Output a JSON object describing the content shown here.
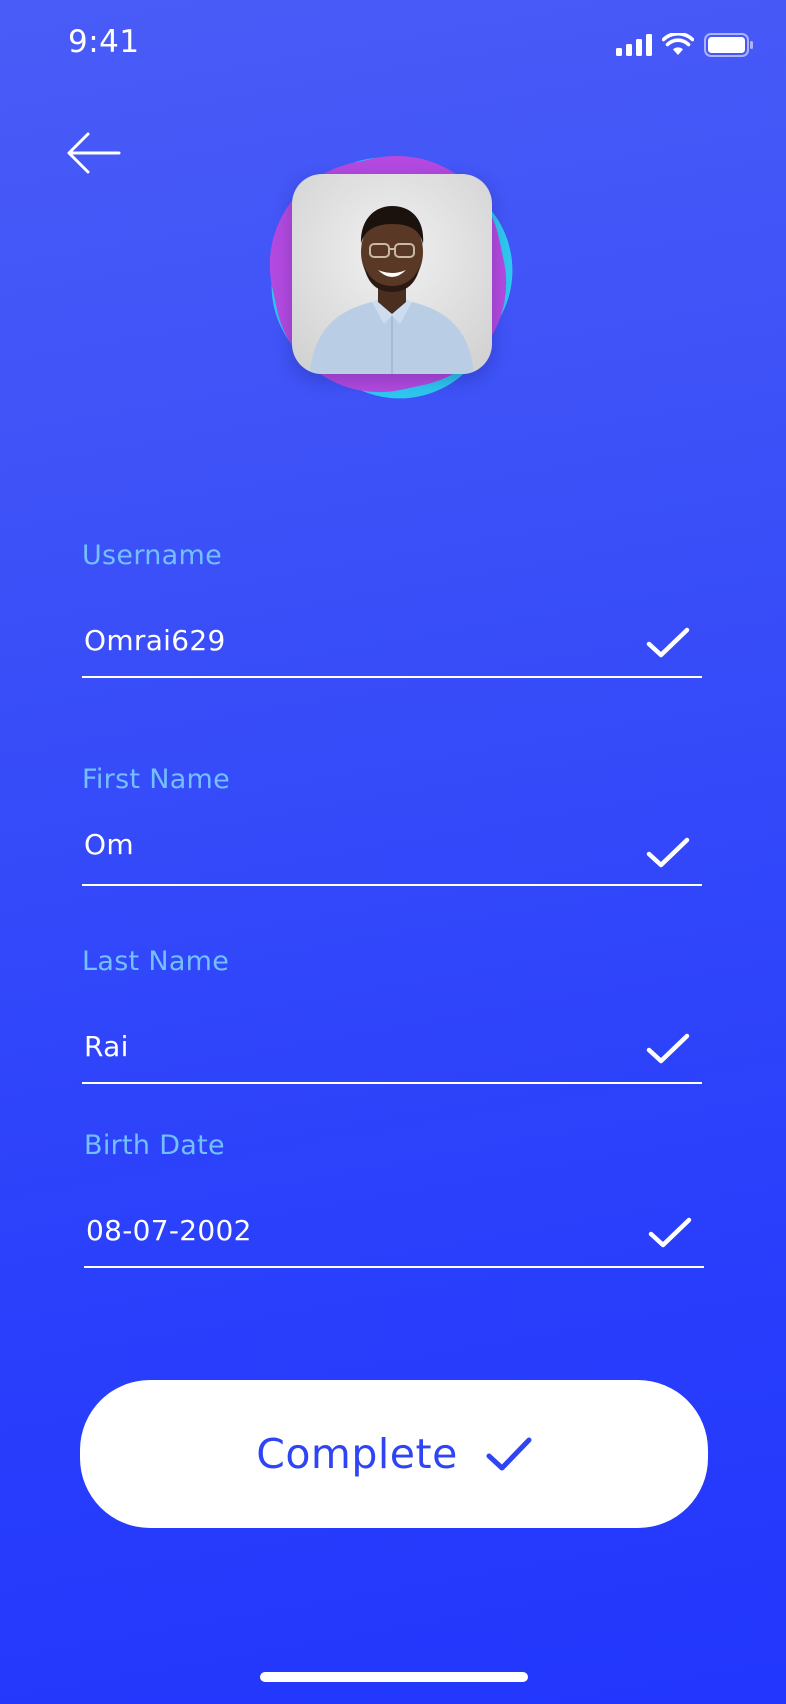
{
  "status_bar": {
    "time": "9:41",
    "icons": [
      "signal-icon",
      "wifi-icon",
      "battery-icon"
    ]
  },
  "header": {
    "back_icon": "arrow-left-icon"
  },
  "avatar": {
    "icon": "profile-photo"
  },
  "form": {
    "username": {
      "label": "Username",
      "value": "Omrai629"
    },
    "first_name": {
      "label": "First Name",
      "value": "Om"
    },
    "last_name": {
      "label": "Last Name",
      "value": "Rai"
    },
    "birth_date": {
      "label": "Birth Date",
      "value": "08-07-2002"
    }
  },
  "complete_button": {
    "label": "Complete",
    "icon": "check-icon"
  },
  "colors": {
    "background_top": "#4a5cf7",
    "background_bottom": "#2236fd",
    "label": "#74c0ff",
    "button_text": "#2f45f5",
    "avatar_purple": "#b44ae0",
    "avatar_cyan": "#2ec8f0"
  }
}
